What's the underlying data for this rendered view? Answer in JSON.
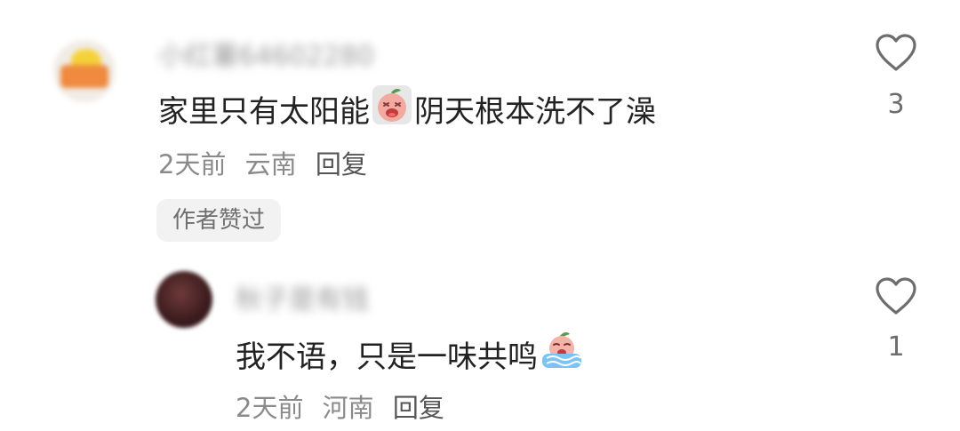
{
  "comments": [
    {
      "username": "小红薯64602280",
      "text_before": "家里只有太阳能",
      "emoji": "crying-face-emoji",
      "text_after": "阴天根本洗不了澡",
      "time": "2天前",
      "location": "云南",
      "reply_label": "回复",
      "author_liked_badge": "作者赞过",
      "like_count": "3",
      "like_icon": "heart-outline-icon"
    },
    {
      "username": "秋子是有钱",
      "text": "我不语，只是一味共鸣",
      "emoji": "sobbing-tears-emoji",
      "time": "2天前",
      "location": "河南",
      "reply_label": "回复",
      "like_count": "1",
      "like_icon": "heart-outline-icon"
    }
  ],
  "colors": {
    "text_primary": "#222222",
    "text_secondary": "#8a8a8a",
    "badge_bg": "#f2f2f2",
    "icon_gray": "#6d6d6d"
  }
}
